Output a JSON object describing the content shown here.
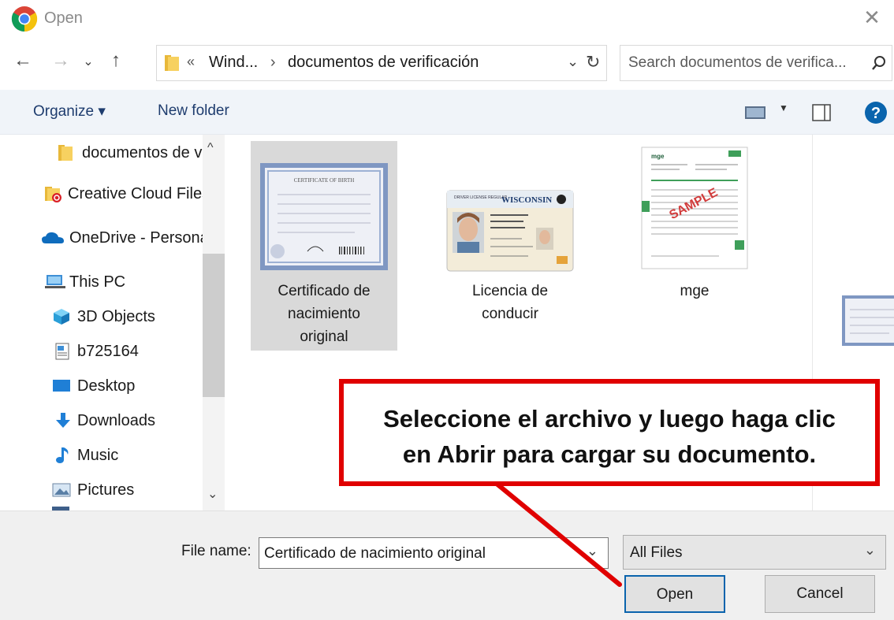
{
  "window": {
    "title": "Open"
  },
  "nav": {
    "path_root": "«",
    "path_segments": [
      "Wind...",
      "documentos de verificación"
    ],
    "path_separator": "›",
    "search_placeholder": "Search documentos de verifica..."
  },
  "toolbar": {
    "organize_label": "Organize ▾",
    "new_folder_label": "New folder"
  },
  "sidebar": {
    "items": [
      {
        "label": "documentos de verificación",
        "icon": "folder-icon"
      },
      {
        "label": "Creative Cloud Files",
        "icon": "creative-cloud-icon"
      },
      {
        "label": "OneDrive - Personal",
        "icon": "onedrive-icon"
      },
      {
        "label": "This PC",
        "icon": "computer-icon"
      },
      {
        "label": "3D Objects",
        "icon": "cube-icon"
      },
      {
        "label": "b725164",
        "icon": "document-icon"
      },
      {
        "label": "Desktop",
        "icon": "desktop-icon"
      },
      {
        "label": "Downloads",
        "icon": "download-icon"
      },
      {
        "label": "Music",
        "icon": "music-icon"
      },
      {
        "label": "Pictures",
        "icon": "pictures-icon"
      }
    ]
  },
  "files": [
    {
      "label_lines": [
        "Certificado de",
        "nacimiento",
        "original"
      ],
      "selected": true
    },
    {
      "label_lines": [
        "Licencia de",
        "conducir"
      ],
      "selected": false
    },
    {
      "label_lines": [
        "mge"
      ],
      "selected": false
    }
  ],
  "thumb_text": {
    "certificate_header": "CERTIFICATE OF BIRTH",
    "license_state": "WISCONSIN",
    "license_class": "DRIVER LICENSE REGULAR",
    "mge_logo": "mge",
    "mge_stamp": "SAMPLE"
  },
  "bottom": {
    "file_name_label": "File name:",
    "file_name_value": "Certificado de nacimiento original",
    "file_type_value": "All Files",
    "open_label": "Open",
    "cancel_label": "Cancel"
  },
  "callout": {
    "line1": "Seleccione el archivo y luego haga clic",
    "line2": "en Abrir para cargar su documento."
  },
  "colors": {
    "callout_border": "#e00000",
    "selection": "#d9d9d9",
    "accent": "#0a64ad"
  }
}
